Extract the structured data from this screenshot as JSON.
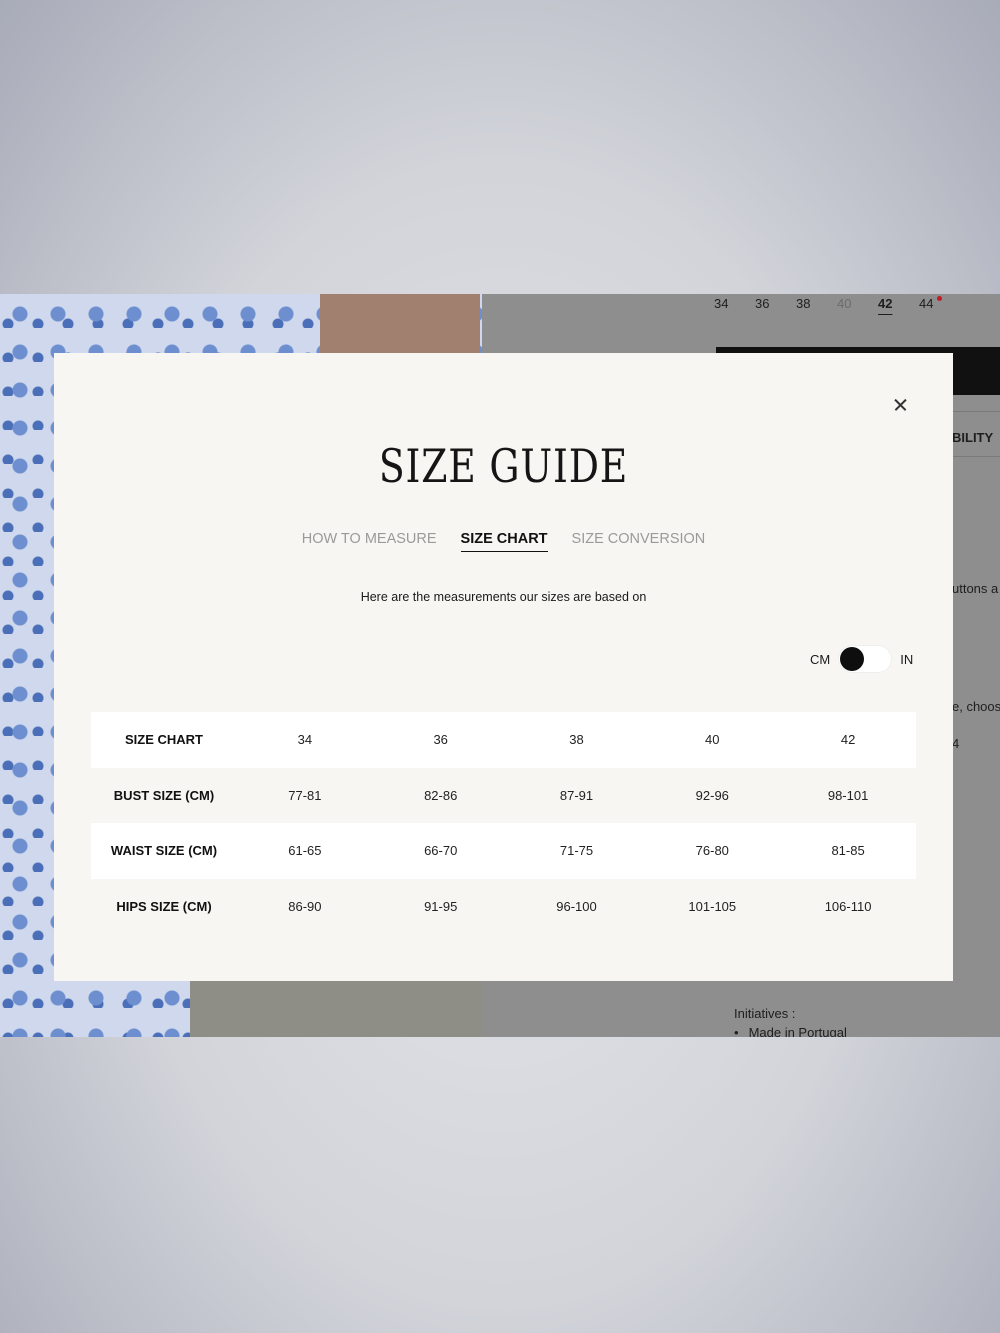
{
  "background_page": {
    "size_selector": {
      "sizes": [
        {
          "label": "34",
          "state": "normal"
        },
        {
          "label": "36",
          "state": "normal"
        },
        {
          "label": "38",
          "state": "normal"
        },
        {
          "label": "40",
          "state": "disabled"
        },
        {
          "label": "42",
          "state": "selected"
        },
        {
          "label": "44",
          "state": "normal"
        }
      ]
    },
    "side_snippets": {
      "bility": "BILITY",
      "uttons": "uttons a",
      "choos": "e, choos",
      "mark": "4"
    },
    "initiatives": {
      "heading": "Initiatives :",
      "items": [
        "Made in Portugal"
      ]
    }
  },
  "modal": {
    "title": "SIZE GUIDE",
    "close_icon": "close-icon",
    "tabs": [
      {
        "label": "HOW TO MEASURE",
        "active": false
      },
      {
        "label": "SIZE CHART",
        "active": true
      },
      {
        "label": "SIZE CONVERSION",
        "active": false
      }
    ],
    "intro": "Here are the measurements our sizes are based on",
    "unit_toggle": {
      "left": "CM",
      "right": "IN",
      "selected": "CM"
    },
    "table": {
      "rows": [
        {
          "label": "SIZE CHART",
          "values": [
            "34",
            "36",
            "38",
            "40",
            "42"
          ]
        },
        {
          "label": "BUST SIZE (CM)",
          "values": [
            "77-81",
            "82-86",
            "87-91",
            "92-96",
            "98-101"
          ]
        },
        {
          "label": "WAIST SIZE (CM)",
          "values": [
            "61-65",
            "66-70",
            "71-75",
            "76-80",
            "81-85"
          ]
        },
        {
          "label": "HIPS SIZE (CM)",
          "values": [
            "86-90",
            "91-95",
            "96-100",
            "101-105",
            "106-110"
          ]
        }
      ]
    }
  },
  "colors": {
    "accent": "#111111",
    "modal_bg": "#f8f6f3",
    "sale_dot": "#c21d25"
  }
}
